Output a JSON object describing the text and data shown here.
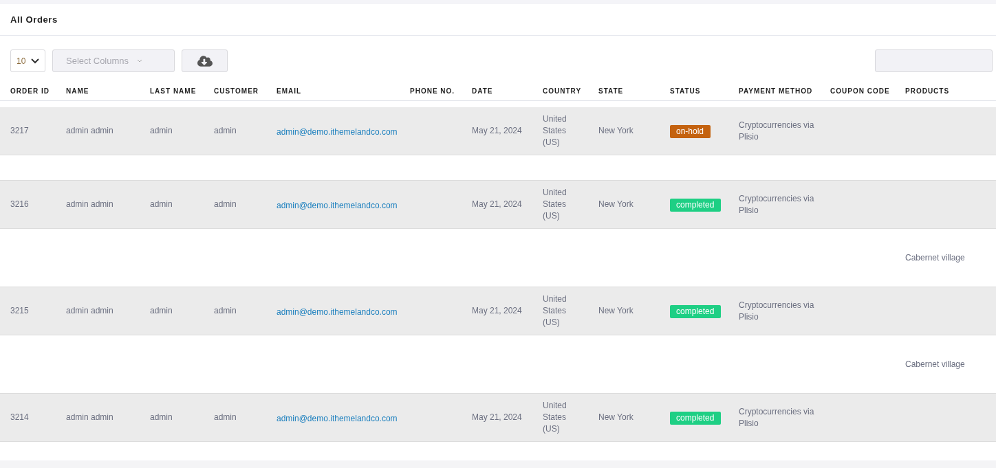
{
  "title": "All Orders",
  "toolbar": {
    "page_size": "10",
    "columns_placeholder": "Select Columns"
  },
  "columns": [
    "ORDER ID",
    "NAME",
    "LAST NAME",
    "CUSTOMER",
    "EMAIL",
    "PHONE NO.",
    "DATE",
    "COUNTRY",
    "STATE",
    "STATUS",
    "PAYMENT METHOD",
    "COUPON CODE",
    "PRODUCTS"
  ],
  "rows": [
    {
      "kind": "order",
      "id": "3217",
      "name": "admin admin",
      "last_name": "admin",
      "customer": "admin",
      "email": "admin@demo.ithemelandco.com",
      "date": "May 21, 2024",
      "country": "United States (US)",
      "state": "New York",
      "status": {
        "label": "on-hold",
        "color": "#c4620f"
      },
      "payment": "Cryptocurrencies via Plisio"
    },
    {
      "kind": "products"
    },
    {
      "kind": "order",
      "id": "3216",
      "name": "admin admin",
      "last_name": "admin",
      "customer": "admin",
      "email": "admin@demo.ithemelandco.com",
      "date": "May 21, 2024",
      "country": "United States (US)",
      "state": "New York",
      "status": {
        "label": "completed",
        "color": "#1ecf84"
      },
      "payment": "Cryptocurrencies via Plisio"
    },
    {
      "kind": "products",
      "products": "Cabernet village"
    },
    {
      "kind": "order",
      "id": "3215",
      "name": "admin admin",
      "last_name": "admin",
      "customer": "admin",
      "email": "admin@demo.ithemelandco.com",
      "date": "May 21, 2024",
      "country": "United States (US)",
      "state": "New York",
      "status": {
        "label": "completed",
        "color": "#1ecf84"
      },
      "payment": "Cryptocurrencies via Plisio"
    },
    {
      "kind": "products",
      "products": "Cabernet village"
    },
    {
      "kind": "order",
      "id": "3214",
      "name": "admin admin",
      "last_name": "admin",
      "customer": "admin",
      "email": "admin@demo.ithemelandco.com",
      "date": "May 21, 2024",
      "country": "United States (US)",
      "state": "New York",
      "status": {
        "label": "completed",
        "color": "#1ecf84"
      },
      "payment": "Cryptocurrencies via Plisio"
    }
  ]
}
